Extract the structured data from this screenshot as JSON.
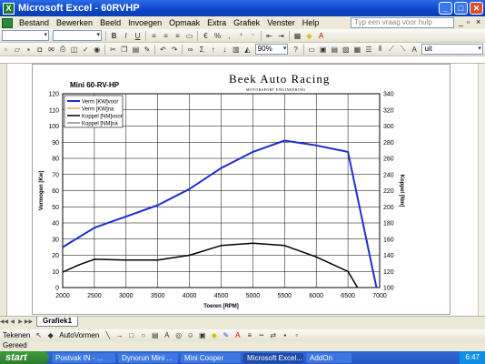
{
  "window": {
    "title": "Microsoft Excel - 60RVHP"
  },
  "menu": {
    "items": [
      "Bestand",
      "Bewerken",
      "Beeld",
      "Invoegen",
      "Opmaak",
      "Extra",
      "Grafiek",
      "Venster",
      "Help"
    ],
    "help_placeholder": "Typ een vraag voor hulp"
  },
  "toolbar": {
    "zoom": "90%",
    "uit_label": "uit"
  },
  "logo": {
    "name": "Beek Auto Racing",
    "sub": "MOTORSPORT ENGINEERING"
  },
  "chart_data": {
    "type": "line",
    "title": "Mini 60-RV-HP",
    "xlabel": "Toeren [RPM]",
    "ylabel": "Vermogen [Kw]",
    "y2label": "Koppel [Nm]",
    "xlim": [
      2000,
      7000
    ],
    "ylim": [
      0,
      120
    ],
    "y2lim": [
      100,
      340
    ],
    "x_ticks": [
      2000,
      2500,
      3000,
      3500,
      4000,
      4500,
      5000,
      5500,
      6000,
      6500,
      7000
    ],
    "y_ticks": [
      0,
      10,
      20,
      30,
      40,
      50,
      60,
      70,
      80,
      90,
      100,
      110,
      120
    ],
    "y2_ticks": [
      100,
      120,
      140,
      160,
      180,
      200,
      220,
      240,
      260,
      280,
      300,
      320,
      340
    ],
    "grid": true,
    "legend": "top-left",
    "series": [
      {
        "name": "Verm [KW]voor",
        "axis": "left",
        "color": "#1f2fcf",
        "width": 2,
        "x": [
          2000,
          2500,
          3000,
          3500,
          4000,
          4500,
          5000,
          5500,
          6000,
          6500,
          6950
        ],
        "values": [
          25,
          37,
          44,
          51,
          61,
          74,
          84,
          91,
          88,
          84,
          0
        ]
      },
      {
        "name": "Verm [KW]na",
        "axis": "left",
        "color": "#e87a2a",
        "width": 1,
        "x": [],
        "values": []
      },
      {
        "name": "Koppel [NM]voor",
        "axis": "right",
        "color": "#000000",
        "width": 1.5,
        "x": [
          2000,
          2250,
          2500,
          3000,
          3500,
          4000,
          4500,
          5000,
          5500,
          6000,
          6500,
          6650
        ],
        "values": [
          119,
          128,
          135,
          134,
          134,
          140,
          152,
          155,
          152,
          138,
          120,
          100
        ]
      },
      {
        "name": "Koppel [NM]na",
        "axis": "right",
        "color": "#555555",
        "width": 1,
        "x": [],
        "values": []
      }
    ]
  },
  "sheet_tab": "Grafiek1",
  "drawbar": {
    "tekenen": "Tekenen",
    "autovormen": "AutoVormen"
  },
  "status": "Gereed",
  "taskbar": {
    "start": "start",
    "tasks": [
      "Postvak IN - ...",
      "Dynorun Mini ...",
      "Mini Cooper",
      "Microsoft Excel...",
      "AddOn"
    ],
    "time": "6:47"
  }
}
